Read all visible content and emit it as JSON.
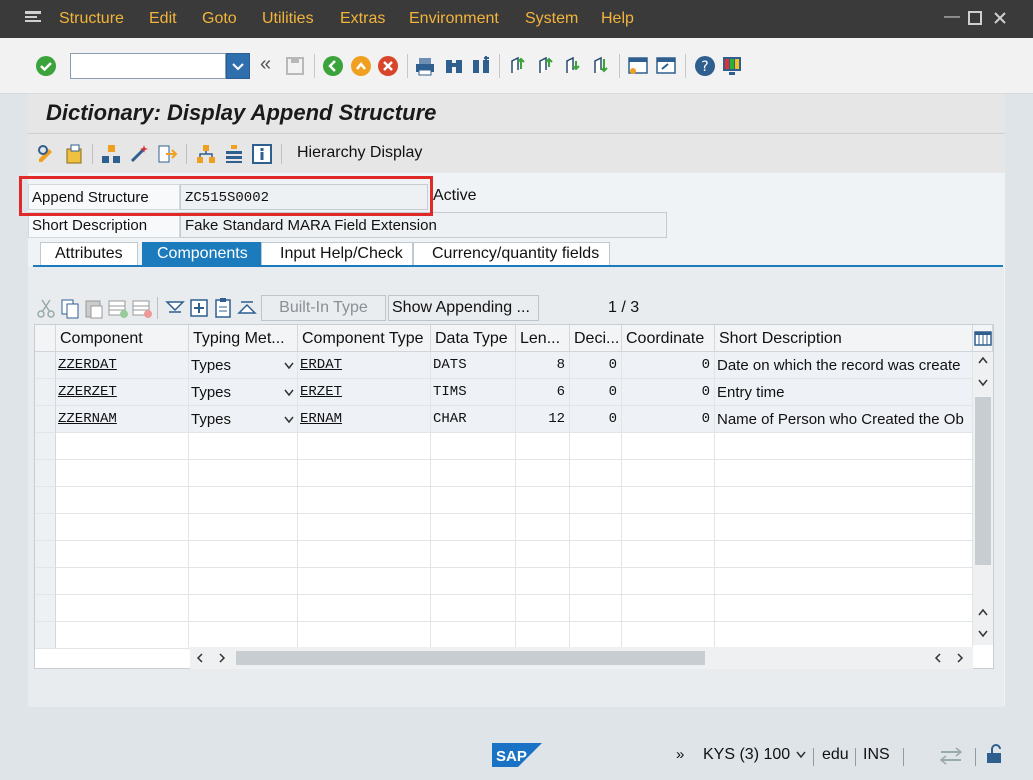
{
  "menu": [
    "Structure",
    "Edit",
    "Goto",
    "Utilities",
    "Extras",
    "Environment",
    "System",
    "Help"
  ],
  "title": "Dictionary: Display Append Structure",
  "app_toolbar": {
    "hierarchy_label": "Hierarchy Display"
  },
  "header": {
    "append_label": "Append Structure",
    "append_value": "ZC515S0002",
    "status": "Active",
    "desc_label": "Short Description",
    "desc_value": "Fake Standard MARA Field Extension"
  },
  "tabs": [
    "Attributes",
    "Components",
    "Input Help/Check",
    "Currency/quantity fields"
  ],
  "active_tab": "Components",
  "table_toolbar": {
    "builtin_label": "Built-In Type",
    "show_appending_label": "Show Appending ...",
    "page_info": "1  /  3"
  },
  "columns": [
    "Component",
    "Typing Met...",
    "Component Type",
    "Data Type",
    "Len...",
    "Deci...",
    "Coordinate",
    "Short Description"
  ],
  "rows": [
    {
      "component": "ZZERDAT",
      "typing": "Types",
      "comp_type": "ERDAT",
      "data_type": "DATS",
      "length": "8",
      "decimals": "0",
      "coordinate": "0",
      "description": "Date on which the record was create"
    },
    {
      "component": "ZZERZET",
      "typing": "Types",
      "comp_type": "ERZET",
      "data_type": "TIMS",
      "length": "6",
      "decimals": "0",
      "coordinate": "0",
      "description": "Entry time"
    },
    {
      "component": "ZZERNAM",
      "typing": "Types",
      "comp_type": "ERNAM",
      "data_type": "CHAR",
      "length": "12",
      "decimals": "0",
      "coordinate": "0",
      "description": "Name of Person who Created the Ob"
    }
  ],
  "status": {
    "logo": "SAP",
    "system": "KYS (3) 100",
    "user": "edu",
    "mode": "INS"
  },
  "colors": {
    "menubar": "#3a3a3a",
    "menu_text": "#f3b43a",
    "accent": "#1b7bbd",
    "highlight": "#e02a2a"
  }
}
